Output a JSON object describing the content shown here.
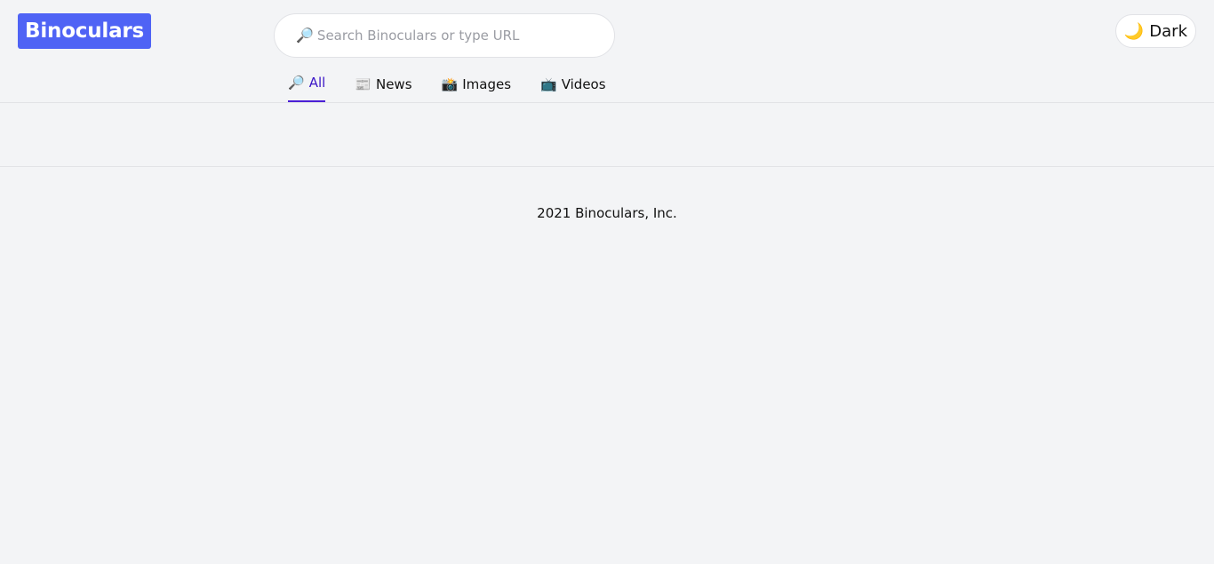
{
  "header": {
    "logo": "Binoculars",
    "search": {
      "icon": "🔎",
      "placeholder": "Search Binoculars or type URL",
      "value": ""
    },
    "theme_toggle": {
      "icon": "🌙",
      "label": "Dark"
    }
  },
  "tabs": [
    {
      "icon": "🔎",
      "label": "All",
      "active": true
    },
    {
      "icon": "📰",
      "label": "News",
      "active": false
    },
    {
      "icon": "📸",
      "label": "Images",
      "active": false
    },
    {
      "icon": "📺",
      "label": "Videos",
      "active": false
    }
  ],
  "footer": {
    "text": "2021 Binoculars, Inc."
  },
  "colors": {
    "brand": "#4f63f5",
    "active_tab": "#4a1fd6",
    "background": "#f3f4f6"
  }
}
